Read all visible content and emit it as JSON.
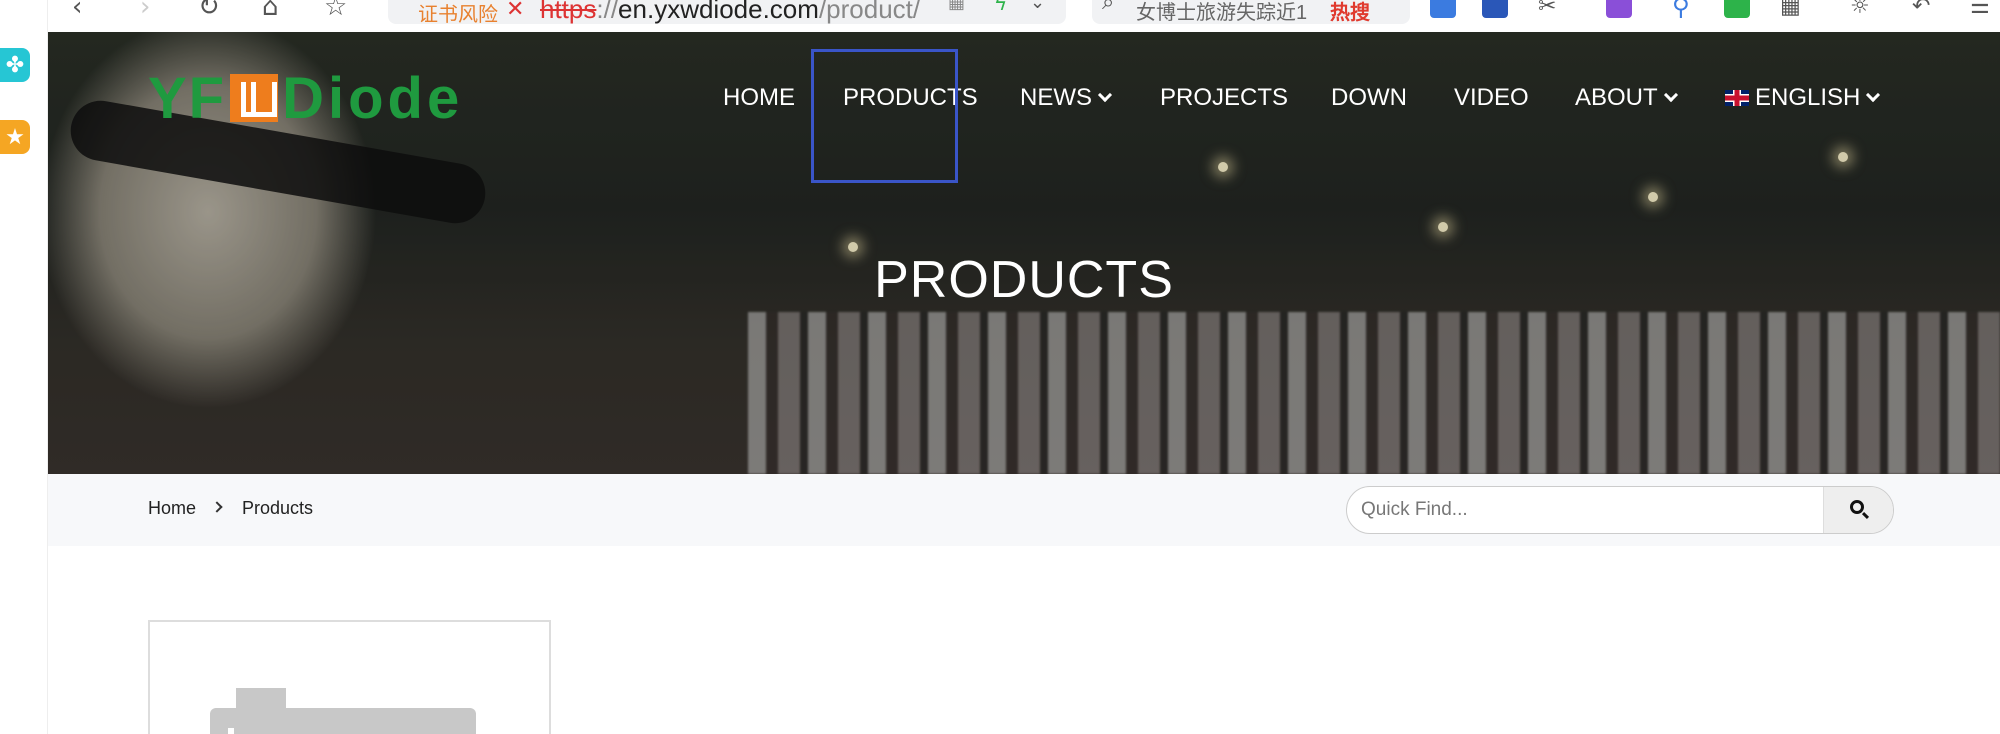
{
  "browser": {
    "cert_warning": "证书风险",
    "url_scheme": "https",
    "url_sep": "://",
    "url_host": "en.yxwdiode.com",
    "url_path": "/product/",
    "search_text": "女博士旅游失踪近1",
    "search_hot": "热搜"
  },
  "logo": {
    "left": "YF",
    "right": "Diode"
  },
  "nav": {
    "home": "HOME",
    "products": "PRODUCTS",
    "news": "NEWS",
    "projects": "PROJECTS",
    "down": "DOWN",
    "video": "VIDEO",
    "about": "ABOUT",
    "language": "ENGLISH"
  },
  "hero": {
    "title": "PRODUCTS"
  },
  "breadcrumb": {
    "home": "Home",
    "current": "Products"
  },
  "search": {
    "placeholder": "Quick Find..."
  },
  "colors": {
    "brand_green": "#1f9a3f",
    "brand_orange": "#ee7d1d",
    "highlight_box": "#3a55c8"
  }
}
